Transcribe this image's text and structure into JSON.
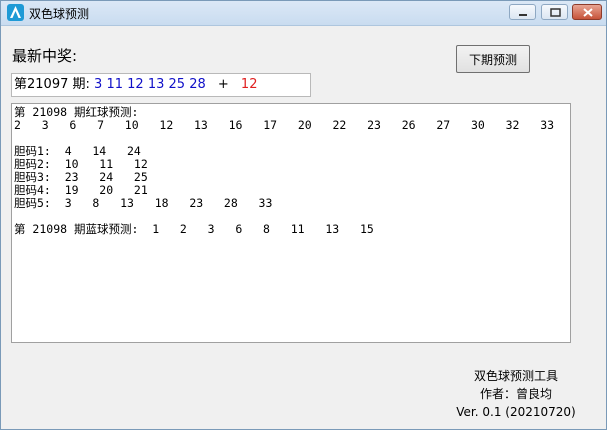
{
  "window": {
    "title": "双色球预测"
  },
  "main": {
    "heading": "最新中奖:",
    "next_button": "下期预测",
    "latest": {
      "issue_label": "第21097  期:",
      "red_balls": [
        "3",
        "11",
        "12",
        "13",
        "25",
        "28"
      ],
      "plus": "+",
      "blue_ball": "12"
    },
    "output_lines": [
      "第 21098 期红球预测:",
      "2   3   6   7   10   12   13   16   17   20   22   23   26   27   30   32   33",
      "",
      "胆码1:  4   14   24",
      "胆码2:  10   11   12",
      "胆码3:  23   24   25",
      "胆码4:  19   20   21",
      "胆码5:  3   8   13   18   23   28   33",
      "",
      "第 21098 期蓝球预测:  1   2   3   6   8   11   13   15"
    ]
  },
  "footer": {
    "line1": "双色球预测工具",
    "line2": "作者：曾良均",
    "line3": "Ver. 0.1 (20210720)"
  },
  "colors": {
    "red_ball": "#e02020",
    "blue_ball_text": "#1010c8"
  }
}
